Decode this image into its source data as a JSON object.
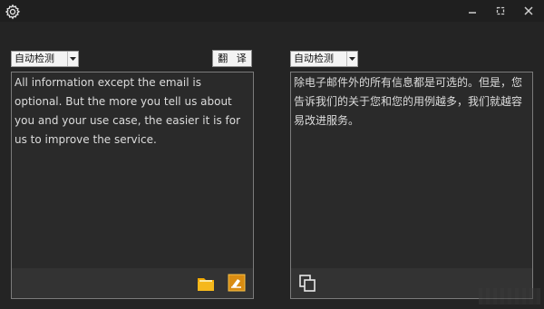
{
  "window": {
    "settings_icon": "gear-icon",
    "controls": [
      "minimize-icon",
      "maximize-icon",
      "close-icon"
    ]
  },
  "source": {
    "language": "自动检测",
    "text": "All information except the email is optional. But the more you tell us about you and your use case, the easier it is for us to improve the service.",
    "footer_icons": [
      "folder-icon",
      "clear-icon"
    ]
  },
  "toolbar": {
    "translate_label": "翻 译"
  },
  "target": {
    "language": "自动检测",
    "text": "除电子邮件外的所有信息都是可选的。但是，您告诉我们的关于您和您的用例越多，我们就越容易改进服务。",
    "footer_icons": [
      "copy-icon"
    ]
  },
  "colors": {
    "background": "#242424",
    "panel": "#2a2a2a",
    "footer": "#333333",
    "text": "#dcdcdc"
  }
}
